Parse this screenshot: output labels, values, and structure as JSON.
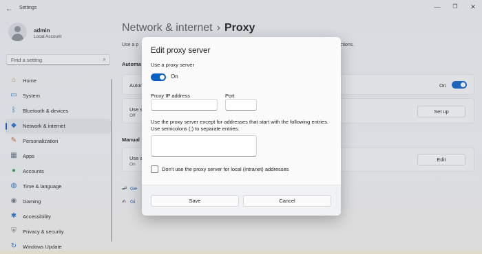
{
  "window": {
    "title": "Settings"
  },
  "user": {
    "name": "admin",
    "account_type": "Local Account"
  },
  "search": {
    "placeholder": "Find a setting"
  },
  "sidebar": {
    "items": [
      {
        "label": "Home",
        "icon": "home-icon",
        "glyph": "⌂",
        "color": "#d48a2c"
      },
      {
        "label": "System",
        "icon": "monitor-icon",
        "glyph": "▭",
        "color": "#1e6fd0"
      },
      {
        "label": "Bluetooth & devices",
        "icon": "bluetooth-icon",
        "glyph": "ᛒ",
        "color": "#1e6fd0"
      },
      {
        "label": "Network & internet",
        "icon": "wifi-icon",
        "glyph": "◆",
        "color": "#1e6fd0"
      },
      {
        "label": "Personalization",
        "icon": "brush-icon",
        "glyph": "✎",
        "color": "#c8622f"
      },
      {
        "label": "Apps",
        "icon": "apps-icon",
        "glyph": "▦",
        "color": "#5a6a80"
      },
      {
        "label": "Accounts",
        "icon": "person-icon",
        "glyph": "●",
        "color": "#2f9a5a"
      },
      {
        "label": "Time & language",
        "icon": "globe-icon",
        "glyph": "◍",
        "color": "#1e6fd0"
      },
      {
        "label": "Gaming",
        "icon": "controller-icon",
        "glyph": "◉",
        "color": "#6b7480"
      },
      {
        "label": "Accessibility",
        "icon": "accessibility-icon",
        "glyph": "✱",
        "color": "#1e6fd0"
      },
      {
        "label": "Privacy & security",
        "icon": "shield-icon",
        "glyph": "⛨",
        "color": "#6b7480"
      },
      {
        "label": "Windows Update",
        "icon": "update-icon",
        "glyph": "↻",
        "color": "#1e6fd0"
      }
    ],
    "active_index": 3
  },
  "header": {
    "parent": "Network & internet",
    "separator": "›",
    "current": "Proxy"
  },
  "content": {
    "description_start": "Use a p",
    "description_end": "ctions.",
    "auto_section": "Automa",
    "auto_card_title": "Autom",
    "auto_toggle_label": "On",
    "setup_card_title": "Use s",
    "setup_card_sub": "Off",
    "setup_button": "Set up",
    "manual_section": "Manual",
    "manual_card_title": "Use a",
    "manual_card_sub": "On",
    "edit_button": "Edit",
    "links": [
      "Ge",
      "Gi"
    ]
  },
  "dialog": {
    "title": "Edit proxy server",
    "use_proxy_label": "Use a proxy server",
    "toggle_state": "On",
    "ip_label": "Proxy IP address",
    "ip_value": "",
    "port_label": "Port",
    "port_value": "",
    "exceptions_help_1": "Use the proxy server except for addresses that start with the following entries.",
    "exceptions_help_2": "Use semicolons (;) to separate entries.",
    "exceptions_value": "",
    "local_checkbox_label": "Don't use the proxy server for local (intranet) addresses",
    "save_button": "Save",
    "cancel_button": "Cancel"
  },
  "colors": {
    "accent": "#0a5fc4"
  }
}
